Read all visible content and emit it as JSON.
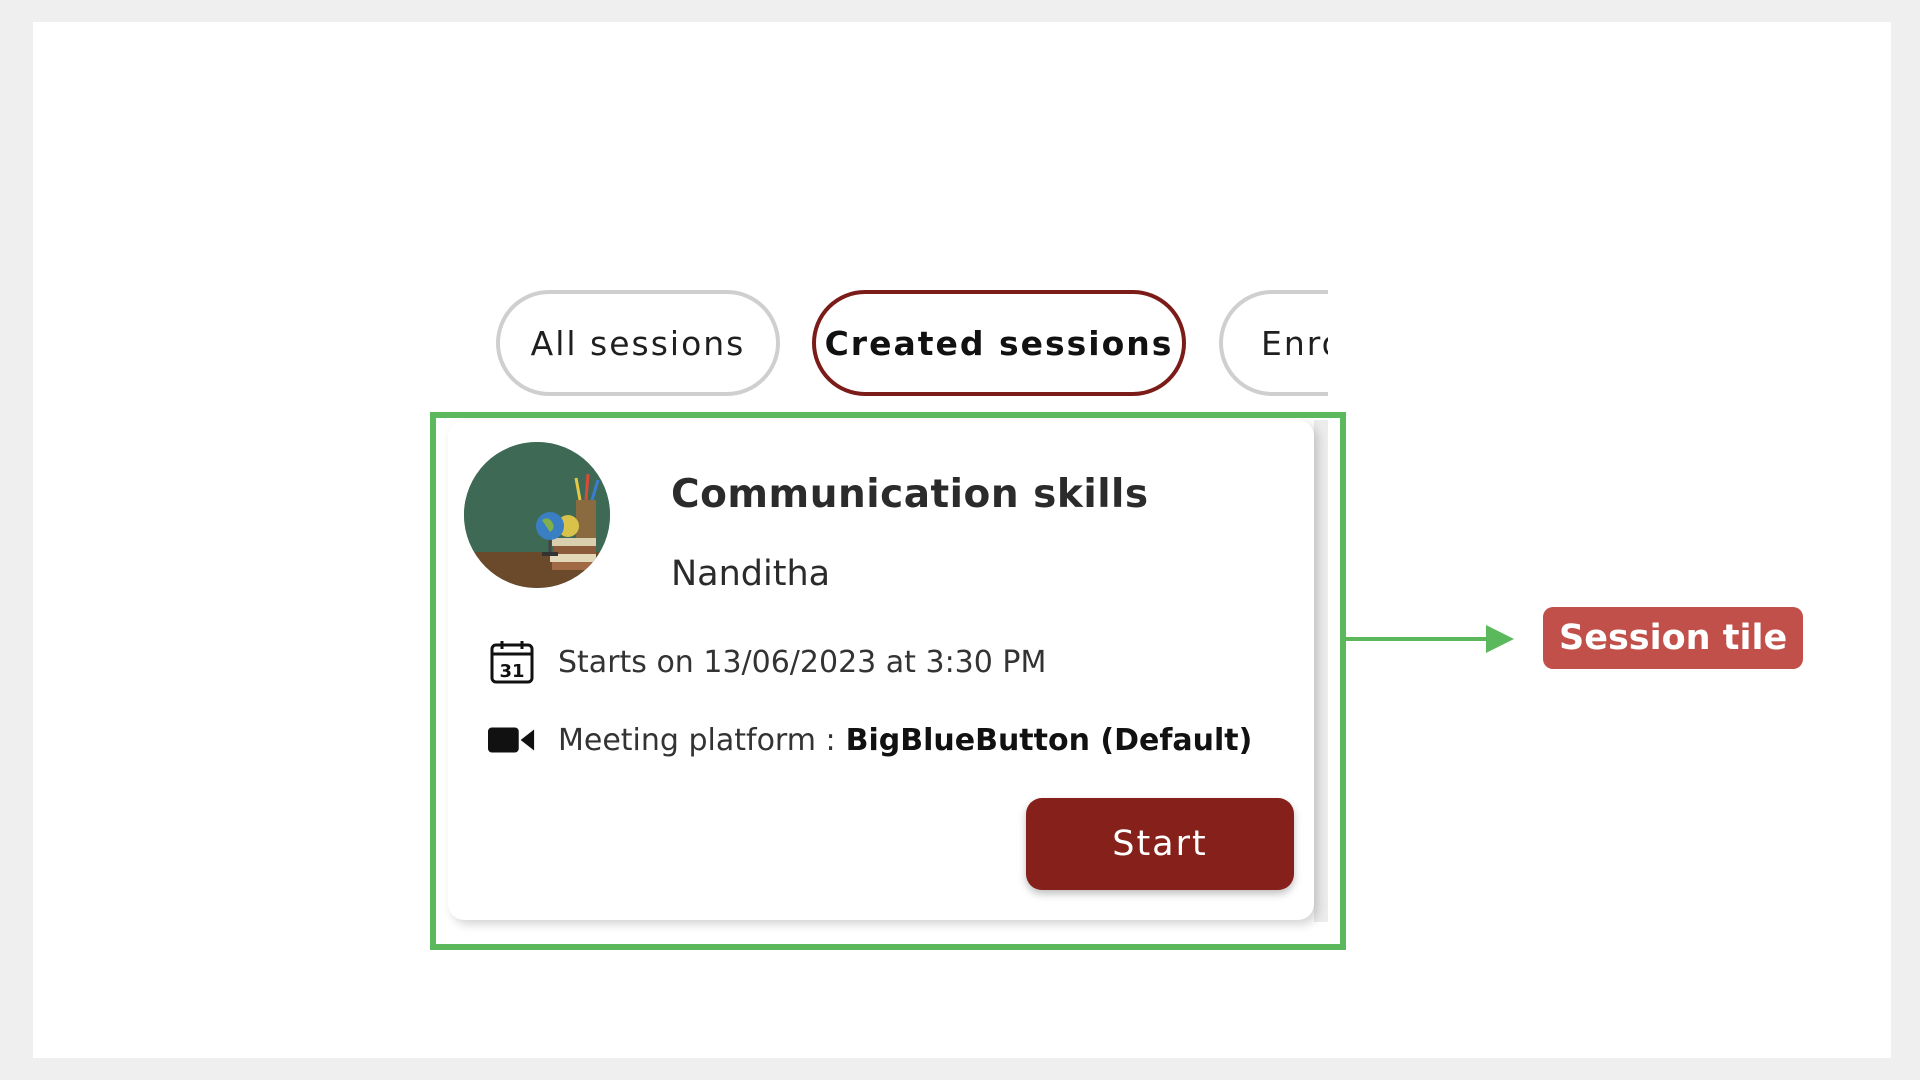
{
  "tabs": {
    "all": "All sessions",
    "created": "Created sessions",
    "enrolled": "Enrolled sessions"
  },
  "session": {
    "title": "Communication skills",
    "host": "Nanditha",
    "start_text": "Starts on 13/06/2023 at 3:30 PM",
    "platform_label": "Meeting platform :",
    "platform_name": "BigBlueButton (Default)",
    "start_button": "Start",
    "calendar_day": "31"
  },
  "annotation": {
    "label": "Session tile"
  },
  "colors": {
    "accent": "#86201a",
    "active_tab_border": "#7b1c18",
    "highlight": "#5cb85c",
    "callout": "#c2504a"
  },
  "icons": [
    "calendar-icon",
    "video-camera-icon"
  ]
}
